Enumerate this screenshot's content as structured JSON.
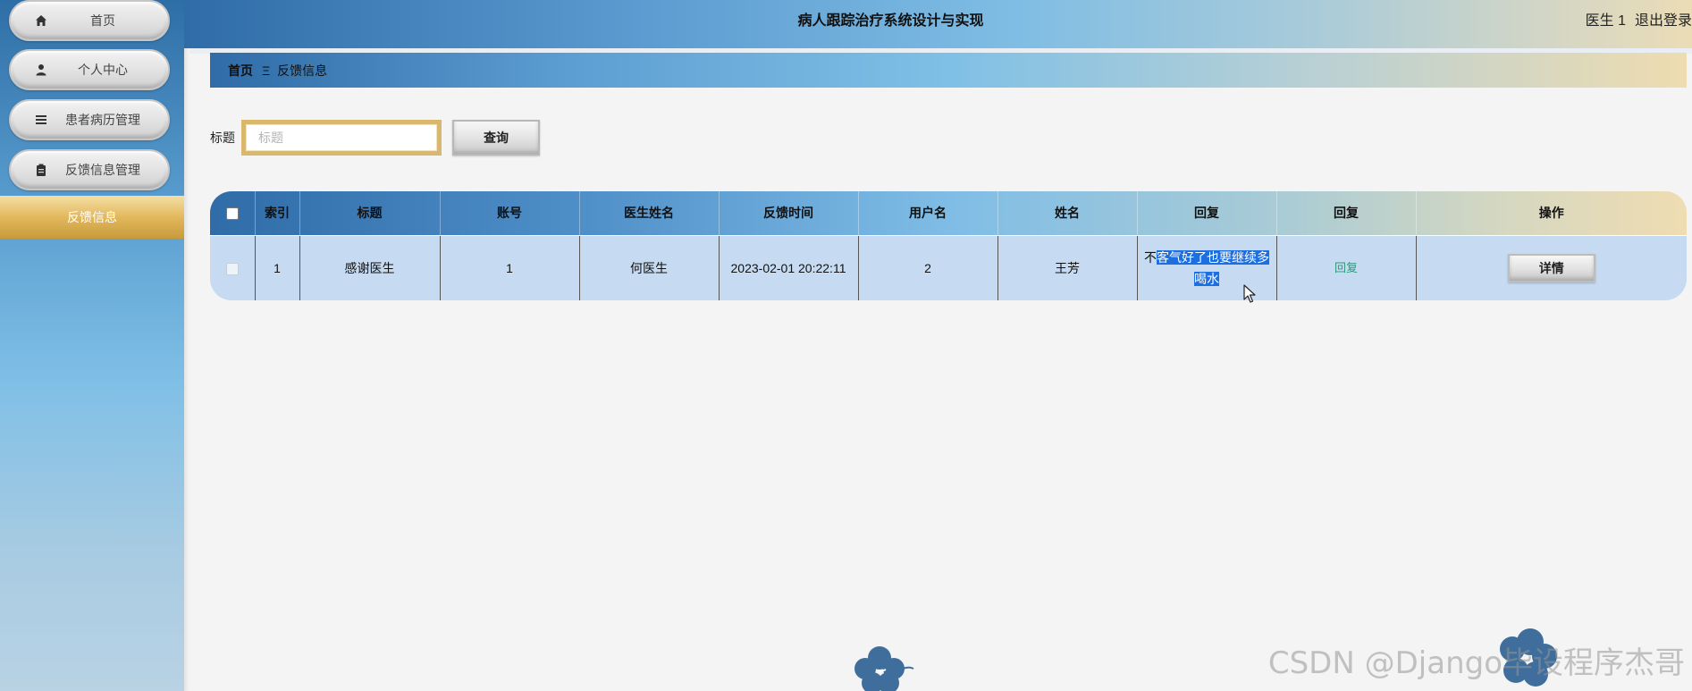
{
  "app": {
    "title": "病人跟踪治疗系统设计与实现"
  },
  "header": {
    "user_label": "医生 1",
    "logout_label": "退出登录"
  },
  "sidebar": {
    "items": [
      {
        "label": "首页",
        "icon": "home-icon"
      },
      {
        "label": "个人中心",
        "icon": "user-icon"
      },
      {
        "label": "患者病历管理",
        "icon": "list-icon"
      },
      {
        "label": "反馈信息管理",
        "icon": "clipboard-icon"
      }
    ],
    "active_item": "反馈信息"
  },
  "breadcrumb": {
    "home": "首页",
    "separator": "Ξ",
    "current": "反馈信息"
  },
  "search": {
    "label": "标题",
    "placeholder": "标题",
    "value": "",
    "button_label": "查询"
  },
  "table": {
    "columns": [
      "索引",
      "标题",
      "账号",
      "医生姓名",
      "反馈时间",
      "用户名",
      "姓名",
      "回复",
      "回复",
      "操作"
    ],
    "rows": [
      {
        "index": "1",
        "title": "感谢医生",
        "account": "1",
        "doctor_name": "何医生",
        "time": "2023-02-01 20:22:11",
        "username": "2",
        "name": "王芳",
        "reply_text_plain": "不",
        "reply_text_selected": "客气好了也要继续多喝水",
        "reply_link": "回复",
        "action_label": "详情"
      }
    ]
  },
  "watermark": "CSDN @Django毕设程序杰哥",
  "colors": {
    "accent_blue": "#2f6ca8",
    "accent_gold": "#e2b85c",
    "row_bg": "#c6dbf2",
    "selection": "#1c6fe0",
    "link_green": "#2a9a7a"
  }
}
